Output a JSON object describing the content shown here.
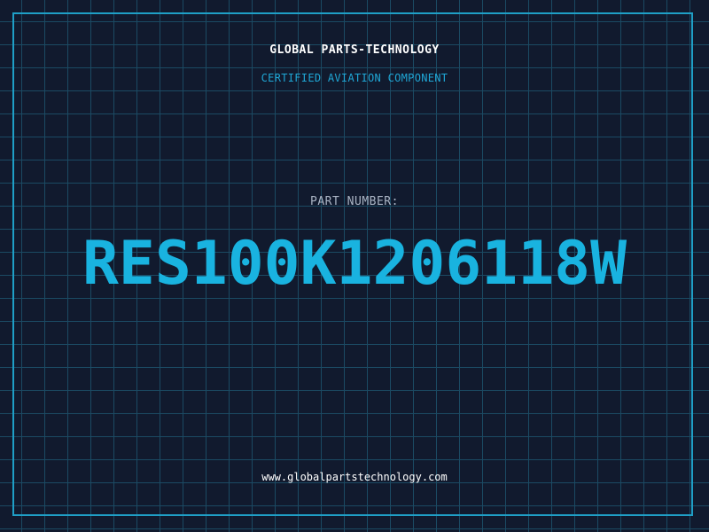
{
  "header": {
    "company": "GLOBAL PARTS-TECHNOLOGY",
    "tagline": "CERTIFIED AVIATION COMPONENT"
  },
  "part": {
    "label": "PART NUMBER:",
    "number": "RES100K1206118W"
  },
  "footer": {
    "website": "www.globalpartstechnology.com"
  },
  "colors": {
    "background": "#111a2e",
    "grid": "#1b4a63",
    "accent": "#19b3e0",
    "border": "#1f9fc6"
  }
}
